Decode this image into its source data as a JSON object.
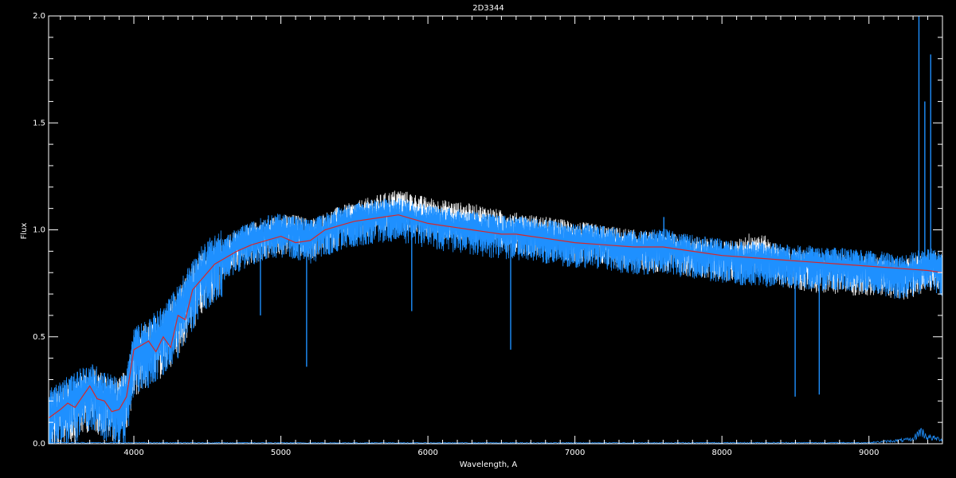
{
  "chart_data": {
    "type": "line",
    "title": "2D3344",
    "xlabel": "Wavelength, A",
    "ylabel": "Flux",
    "xlim": [
      3420,
      9500
    ],
    "ylim": [
      0.0,
      2.0
    ],
    "xticks": [
      4000,
      5000,
      6000,
      7000,
      8000,
      9000
    ],
    "xtick_labels": [
      "4000",
      "5000",
      "6000",
      "7000",
      "8000",
      "9000"
    ],
    "yticks": [
      0.0,
      0.5,
      1.0,
      1.5,
      2.0
    ],
    "ytick_labels": [
      "0.0",
      "0.5",
      "1.0",
      "1.5",
      "2.0"
    ],
    "grid": false,
    "legend": "none",
    "colors": {
      "background": "#000000",
      "axes": "#ffffff",
      "observed": "#ffffff",
      "model": "#1e90ff",
      "smoothed": "#d62728"
    },
    "series": [
      {
        "role": "observed",
        "x": [
          3420,
          3500,
          3600,
          3700,
          3800,
          3900,
          3950,
          4000,
          4100,
          4200,
          4300,
          4400,
          4500,
          4600,
          4700,
          4800,
          4900,
          5000,
          5100,
          5200,
          5300,
          5400,
          5500,
          5600,
          5700,
          5800,
          5900,
          6000,
          6100,
          6200,
          6300,
          6400,
          6500,
          6600,
          6700,
          6800,
          6900,
          7000,
          7100,
          7200,
          7300,
          7400,
          7500,
          7600,
          7700,
          7800,
          7900,
          8000,
          8100,
          8200,
          8300,
          8400,
          8500,
          8600,
          8700,
          8800,
          8900,
          9000,
          9100,
          9200,
          9300,
          9400,
          9500
        ],
        "y": [
          0.12,
          0.16,
          0.2,
          0.25,
          0.22,
          0.19,
          0.24,
          0.4,
          0.46,
          0.5,
          0.6,
          0.72,
          0.82,
          0.88,
          0.93,
          0.96,
          0.98,
          1.0,
          1.0,
          0.98,
          1.01,
          1.04,
          1.06,
          1.08,
          1.1,
          1.12,
          1.1,
          1.08,
          1.07,
          1.06,
          1.05,
          1.04,
          1.02,
          1.01,
          1.0,
          0.99,
          0.98,
          0.97,
          0.96,
          0.95,
          0.94,
          0.93,
          0.92,
          0.92,
          0.91,
          0.9,
          0.89,
          0.88,
          0.88,
          0.92,
          0.9,
          0.85,
          0.84,
          0.83,
          0.82,
          0.82,
          0.81,
          0.81,
          0.8,
          0.79,
          0.8,
          0.83,
          0.82
        ]
      },
      {
        "role": "model",
        "x": [
          3420,
          3500,
          3600,
          3700,
          3800,
          3900,
          3950,
          4000,
          4100,
          4200,
          4300,
          4400,
          4500,
          4600,
          4700,
          4800,
          4900,
          5000,
          5100,
          5200,
          5300,
          5400,
          5500,
          5600,
          5700,
          5800,
          5900,
          6000,
          6100,
          6200,
          6300,
          6400,
          6500,
          6600,
          6700,
          6800,
          6900,
          7000,
          7100,
          7200,
          7300,
          7400,
          7500,
          7600,
          7700,
          7800,
          7900,
          8000,
          8100,
          8200,
          8300,
          8400,
          8500,
          8600,
          8700,
          8800,
          8900,
          9000,
          9100,
          9200,
          9300,
          9400,
          9500
        ],
        "y": [
          0.13,
          0.17,
          0.21,
          0.26,
          0.22,
          0.18,
          0.22,
          0.42,
          0.47,
          0.52,
          0.62,
          0.74,
          0.84,
          0.88,
          0.93,
          0.96,
          0.99,
          1.0,
          0.99,
          0.97,
          1.0,
          1.03,
          1.05,
          1.06,
          1.07,
          1.07,
          1.06,
          1.04,
          1.03,
          1.02,
          1.01,
          1.0,
          0.99,
          0.99,
          0.98,
          0.97,
          0.96,
          0.95,
          0.95,
          0.94,
          0.93,
          0.92,
          0.92,
          0.93,
          0.91,
          0.9,
          0.89,
          0.88,
          0.87,
          0.87,
          0.86,
          0.86,
          0.85,
          0.85,
          0.84,
          0.84,
          0.83,
          0.83,
          0.82,
          0.8,
          0.82,
          0.84,
          0.82
        ]
      },
      {
        "role": "smoothed",
        "x": [
          3420,
          3500,
          3550,
          3600,
          3650,
          3700,
          3750,
          3800,
          3850,
          3900,
          3950,
          4000,
          4050,
          4100,
          4150,
          4200,
          4250,
          4300,
          4350,
          4400,
          4450,
          4500,
          4550,
          4600,
          4700,
          4800,
          4900,
          5000,
          5100,
          5200,
          5300,
          5400,
          5500,
          5600,
          5700,
          5800,
          5900,
          6000,
          6100,
          6200,
          6300,
          6400,
          6500,
          6600,
          6700,
          6800,
          6900,
          7000,
          7200,
          7400,
          7600,
          7800,
          8000,
          8200,
          8400,
          8600,
          8800,
          9000,
          9200,
          9400,
          9500
        ],
        "y": [
          0.12,
          0.16,
          0.19,
          0.17,
          0.22,
          0.27,
          0.21,
          0.2,
          0.15,
          0.16,
          0.22,
          0.44,
          0.46,
          0.48,
          0.43,
          0.5,
          0.45,
          0.6,
          0.58,
          0.72,
          0.76,
          0.8,
          0.84,
          0.86,
          0.9,
          0.93,
          0.95,
          0.97,
          0.94,
          0.95,
          1.0,
          1.02,
          1.04,
          1.05,
          1.06,
          1.07,
          1.05,
          1.03,
          1.02,
          1.01,
          1.0,
          0.99,
          0.98,
          0.98,
          0.97,
          0.96,
          0.95,
          0.94,
          0.93,
          0.92,
          0.92,
          0.9,
          0.88,
          0.87,
          0.86,
          0.85,
          0.84,
          0.83,
          0.82,
          0.81,
          0.8
        ]
      }
    ],
    "absorption_lines": [
      {
        "x": 3934,
        "y": 0.05
      },
      {
        "x": 4300,
        "y": 0.4
      },
      {
        "x": 4861,
        "y": 0.6
      },
      {
        "x": 5175,
        "y": 0.36
      },
      {
        "x": 5890,
        "y": 0.62
      },
      {
        "x": 6563,
        "y": 0.44
      },
      {
        "x": 8498,
        "y": 0.22
      },
      {
        "x": 8662,
        "y": 0.23
      }
    ],
    "emission_lines": [
      {
        "x": 7605,
        "y": 1.06
      },
      {
        "x": 9340,
        "y": 2.0
      },
      {
        "x": 9380,
        "y": 1.6
      },
      {
        "x": 9420,
        "y": 1.82
      }
    ],
    "error_spectrum": {
      "x": [
        3420,
        5000,
        7000,
        9000,
        9300,
        9350,
        9400,
        9500
      ],
      "y": [
        0.005,
        0.004,
        0.004,
        0.005,
        0.02,
        0.06,
        0.03,
        0.02
      ]
    }
  }
}
